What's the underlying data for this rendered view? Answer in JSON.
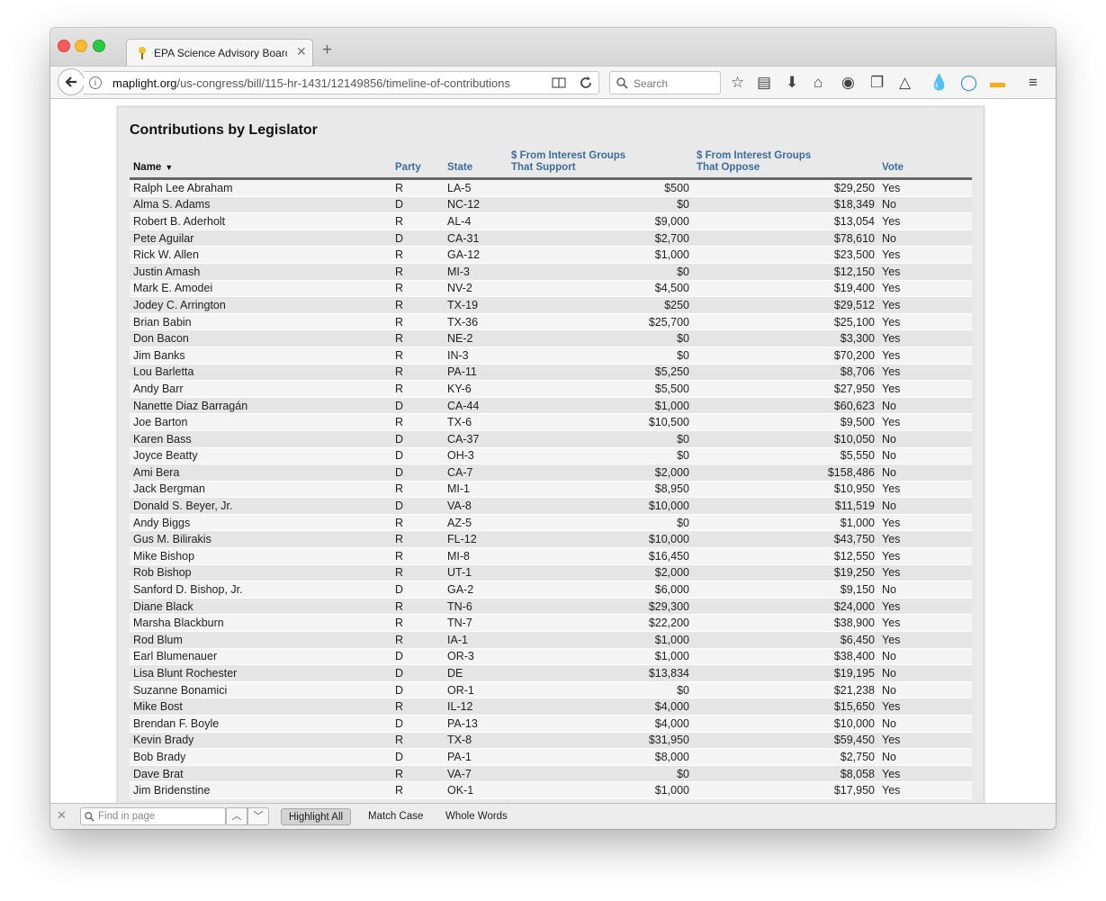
{
  "browser": {
    "tab_title": "EPA Science Advisory Board R",
    "url_host": "maplight.org",
    "url_path": "/us-congress/bill/115-hr-1431/12149856/timeline-of-contributions",
    "search_placeholder": "Search"
  },
  "findbar": {
    "placeholder": "Find in page",
    "highlight_all": "Highlight All",
    "match_case": "Match Case",
    "whole_words": "Whole Words"
  },
  "table": {
    "title": "Contributions by Legislator",
    "headers": {
      "name": "Name",
      "party": "Party",
      "state": "State",
      "support_1": "$ From Interest Groups",
      "support_2": "That Support",
      "oppose_1": "$ From Interest Groups",
      "oppose_2": "That Oppose",
      "vote": "Vote"
    },
    "rows": [
      {
        "name": "Ralph Lee Abraham",
        "party": "R",
        "state": "LA-5",
        "support": "$500",
        "oppose": "$29,250",
        "vote": "Yes"
      },
      {
        "name": "Alma S. Adams",
        "party": "D",
        "state": "NC-12",
        "support": "$0",
        "oppose": "$18,349",
        "vote": "No"
      },
      {
        "name": "Robert B. Aderholt",
        "party": "R",
        "state": "AL-4",
        "support": "$9,000",
        "oppose": "$13,054",
        "vote": "Yes"
      },
      {
        "name": "Pete Aguilar",
        "party": "D",
        "state": "CA-31",
        "support": "$2,700",
        "oppose": "$78,610",
        "vote": "No"
      },
      {
        "name": "Rick W. Allen",
        "party": "R",
        "state": "GA-12",
        "support": "$1,000",
        "oppose": "$23,500",
        "vote": "Yes"
      },
      {
        "name": "Justin Amash",
        "party": "R",
        "state": "MI-3",
        "support": "$0",
        "oppose": "$12,150",
        "vote": "Yes"
      },
      {
        "name": "Mark E. Amodei",
        "party": "R",
        "state": "NV-2",
        "support": "$4,500",
        "oppose": "$19,400",
        "vote": "Yes"
      },
      {
        "name": "Jodey C. Arrington",
        "party": "R",
        "state": "TX-19",
        "support": "$250",
        "oppose": "$29,512",
        "vote": "Yes"
      },
      {
        "name": "Brian Babin",
        "party": "R",
        "state": "TX-36",
        "support": "$25,700",
        "oppose": "$25,100",
        "vote": "Yes"
      },
      {
        "name": "Don Bacon",
        "party": "R",
        "state": "NE-2",
        "support": "$0",
        "oppose": "$3,300",
        "vote": "Yes"
      },
      {
        "name": "Jim Banks",
        "party": "R",
        "state": "IN-3",
        "support": "$0",
        "oppose": "$70,200",
        "vote": "Yes"
      },
      {
        "name": "Lou Barletta",
        "party": "R",
        "state": "PA-11",
        "support": "$5,250",
        "oppose": "$8,706",
        "vote": "Yes"
      },
      {
        "name": "Andy Barr",
        "party": "R",
        "state": "KY-6",
        "support": "$5,500",
        "oppose": "$27,950",
        "vote": "Yes"
      },
      {
        "name": "Nanette Diaz Barragán",
        "party": "D",
        "state": "CA-44",
        "support": "$1,000",
        "oppose": "$60,623",
        "vote": "No"
      },
      {
        "name": "Joe Barton",
        "party": "R",
        "state": "TX-6",
        "support": "$10,500",
        "oppose": "$9,500",
        "vote": "Yes"
      },
      {
        "name": "Karen Bass",
        "party": "D",
        "state": "CA-37",
        "support": "$0",
        "oppose": "$10,050",
        "vote": "No"
      },
      {
        "name": "Joyce Beatty",
        "party": "D",
        "state": "OH-3",
        "support": "$0",
        "oppose": "$5,550",
        "vote": "No"
      },
      {
        "name": "Ami Bera",
        "party": "D",
        "state": "CA-7",
        "support": "$2,000",
        "oppose": "$158,486",
        "vote": "No"
      },
      {
        "name": "Jack Bergman",
        "party": "R",
        "state": "MI-1",
        "support": "$8,950",
        "oppose": "$10,950",
        "vote": "Yes"
      },
      {
        "name": "Donald S. Beyer, Jr.",
        "party": "D",
        "state": "VA-8",
        "support": "$10,000",
        "oppose": "$11,519",
        "vote": "No"
      },
      {
        "name": "Andy Biggs",
        "party": "R",
        "state": "AZ-5",
        "support": "$0",
        "oppose": "$1,000",
        "vote": "Yes"
      },
      {
        "name": "Gus M. Bilirakis",
        "party": "R",
        "state": "FL-12",
        "support": "$10,000",
        "oppose": "$43,750",
        "vote": "Yes"
      },
      {
        "name": "Mike Bishop",
        "party": "R",
        "state": "MI-8",
        "support": "$16,450",
        "oppose": "$12,550",
        "vote": "Yes"
      },
      {
        "name": "Rob Bishop",
        "party": "R",
        "state": "UT-1",
        "support": "$2,000",
        "oppose": "$19,250",
        "vote": "Yes"
      },
      {
        "name": "Sanford D. Bishop, Jr.",
        "party": "D",
        "state": "GA-2",
        "support": "$6,000",
        "oppose": "$9,150",
        "vote": "No"
      },
      {
        "name": "Diane Black",
        "party": "R",
        "state": "TN-6",
        "support": "$29,300",
        "oppose": "$24,000",
        "vote": "Yes"
      },
      {
        "name": "Marsha Blackburn",
        "party": "R",
        "state": "TN-7",
        "support": "$22,200",
        "oppose": "$38,900",
        "vote": "Yes"
      },
      {
        "name": "Rod Blum",
        "party": "R",
        "state": "IA-1",
        "support": "$1,000",
        "oppose": "$6,450",
        "vote": "Yes"
      },
      {
        "name": "Earl Blumenauer",
        "party": "D",
        "state": "OR-3",
        "support": "$1,000",
        "oppose": "$38,400",
        "vote": "No"
      },
      {
        "name": "Lisa Blunt Rochester",
        "party": "D",
        "state": "DE",
        "support": "$13,834",
        "oppose": "$19,195",
        "vote": "No"
      },
      {
        "name": "Suzanne Bonamici",
        "party": "D",
        "state": "OR-1",
        "support": "$0",
        "oppose": "$21,238",
        "vote": "No"
      },
      {
        "name": "Mike Bost",
        "party": "R",
        "state": "IL-12",
        "support": "$4,000",
        "oppose": "$15,650",
        "vote": "Yes"
      },
      {
        "name": "Brendan F. Boyle",
        "party": "D",
        "state": "PA-13",
        "support": "$4,000",
        "oppose": "$10,000",
        "vote": "No"
      },
      {
        "name": "Kevin Brady",
        "party": "R",
        "state": "TX-8",
        "support": "$31,950",
        "oppose": "$59,450",
        "vote": "Yes"
      },
      {
        "name": "Bob Brady",
        "party": "D",
        "state": "PA-1",
        "support": "$8,000",
        "oppose": "$2,750",
        "vote": "No"
      },
      {
        "name": "Dave Brat",
        "party": "R",
        "state": "VA-7",
        "support": "$0",
        "oppose": "$8,058",
        "vote": "Yes"
      },
      {
        "name": "Jim Bridenstine",
        "party": "R",
        "state": "OK-1",
        "support": "$1,000",
        "oppose": "$17,950",
        "vote": "Yes"
      }
    ]
  }
}
